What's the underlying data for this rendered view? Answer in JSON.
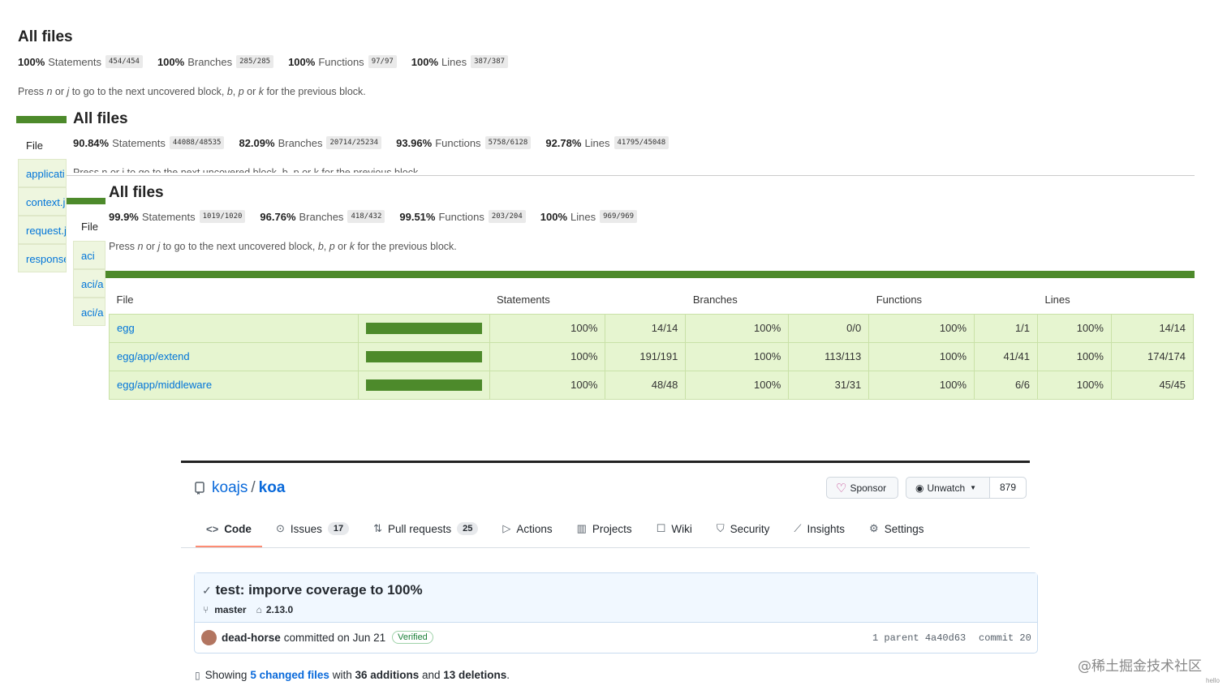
{
  "report1": {
    "title": "All files",
    "stats": [
      {
        "pct": "100%",
        "label": "Statements",
        "frac": "454/454"
      },
      {
        "pct": "100%",
        "label": "Branches",
        "frac": "285/285"
      },
      {
        "pct": "100%",
        "label": "Functions",
        "frac": "97/97"
      },
      {
        "pct": "100%",
        "label": "Lines",
        "frac": "387/387"
      }
    ],
    "hint": [
      "Press ",
      "n",
      " or ",
      "j",
      " to go to the next uncovered block, ",
      "b",
      ", ",
      "p",
      " or ",
      "k",
      " for the previous block."
    ],
    "file_header": "File",
    "files": [
      "applicati",
      "context.j",
      "request.j",
      "response"
    ]
  },
  "report2": {
    "title": "All files",
    "stats": [
      {
        "pct": "90.84%",
        "label": "Statements",
        "frac": "44088/48535"
      },
      {
        "pct": "82.09%",
        "label": "Branches",
        "frac": "20714/25234"
      },
      {
        "pct": "93.96%",
        "label": "Functions",
        "frac": "5758/6128"
      },
      {
        "pct": "92.78%",
        "label": "Lines",
        "frac": "41795/45048"
      }
    ],
    "hint_partial": "Press n or j to go to the next uncovered block, b, p or k for the previous block.",
    "file_header": "File",
    "files": [
      "aci",
      "aci/a",
      "aci/a"
    ]
  },
  "report3": {
    "title": "All files",
    "stats": [
      {
        "pct": "99.9%",
        "label": "Statements",
        "frac": "1019/1020"
      },
      {
        "pct": "96.76%",
        "label": "Branches",
        "frac": "418/432"
      },
      {
        "pct": "99.51%",
        "label": "Functions",
        "frac": "203/204"
      },
      {
        "pct": "100%",
        "label": "Lines",
        "frac": "969/969"
      }
    ],
    "hint": [
      "Press ",
      "n",
      " or ",
      "j",
      " to go to the next uncovered block, ",
      "b",
      ", ",
      "p",
      " or ",
      "k",
      " for the previous block."
    ],
    "headers": {
      "file": "File",
      "statements": "Statements",
      "branches": "Branches",
      "functions": "Functions",
      "lines": "Lines"
    },
    "rows": [
      {
        "file": "egg",
        "coverage": 1.0,
        "s_pct": "100%",
        "s_frac": "14/14",
        "b_pct": "100%",
        "b_frac": "0/0",
        "f_pct": "100%",
        "f_frac": "1/1",
        "l_pct": "100%",
        "l_frac": "14/14"
      },
      {
        "file": "egg/app/extend",
        "coverage": 1.0,
        "s_pct": "100%",
        "s_frac": "191/191",
        "b_pct": "100%",
        "b_frac": "113/113",
        "f_pct": "100%",
        "f_frac": "41/41",
        "l_pct": "100%",
        "l_frac": "174/174"
      },
      {
        "file": "egg/app/middleware",
        "coverage": 1.0,
        "s_pct": "100%",
        "s_frac": "48/48",
        "b_pct": "100%",
        "b_frac": "31/31",
        "f_pct": "100%",
        "f_frac": "6/6",
        "l_pct": "100%",
        "l_frac": "45/45"
      }
    ]
  },
  "github": {
    "owner": "koajs",
    "sep": "/",
    "repo": "koa",
    "sponsor": "Sponsor",
    "watch": "Unwatch",
    "watch_count": "879",
    "tabs": [
      {
        "icon": "code-icon",
        "glyph": "<>",
        "label": "Code",
        "count": ""
      },
      {
        "icon": "issues-icon",
        "glyph": "⊙",
        "label": "Issues",
        "count": "17"
      },
      {
        "icon": "pull-request-icon",
        "glyph": "⇅",
        "label": "Pull requests",
        "count": "25"
      },
      {
        "icon": "actions-icon",
        "glyph": "▷",
        "label": "Actions",
        "count": ""
      },
      {
        "icon": "projects-icon",
        "glyph": "▥",
        "label": "Projects",
        "count": ""
      },
      {
        "icon": "wiki-icon",
        "glyph": "☐",
        "label": "Wiki",
        "count": ""
      },
      {
        "icon": "security-icon",
        "glyph": "⛉",
        "label": "Security",
        "count": ""
      },
      {
        "icon": "insights-icon",
        "glyph": "⟋",
        "label": "Insights",
        "count": ""
      },
      {
        "icon": "settings-icon",
        "glyph": "⚙",
        "label": "Settings",
        "count": ""
      }
    ],
    "commit": {
      "title": "test: imporve coverage to 100%",
      "branch": "master",
      "tag": "2.13.0",
      "author": "dead-horse",
      "action": "committed on Jun 21",
      "verified": "Verified",
      "parent_label": "1 parent",
      "parent_sha": "4a40d63",
      "commit_label": "commit 20"
    },
    "summary": {
      "prefix": "Showing ",
      "changed": "5 changed files",
      "with": " with ",
      "additions": "36 additions",
      "and": " and ",
      "deletions": "13 deletions",
      "end": "."
    }
  },
  "watermark": "@稀土掘金技术社区",
  "watermark_small": "hello"
}
